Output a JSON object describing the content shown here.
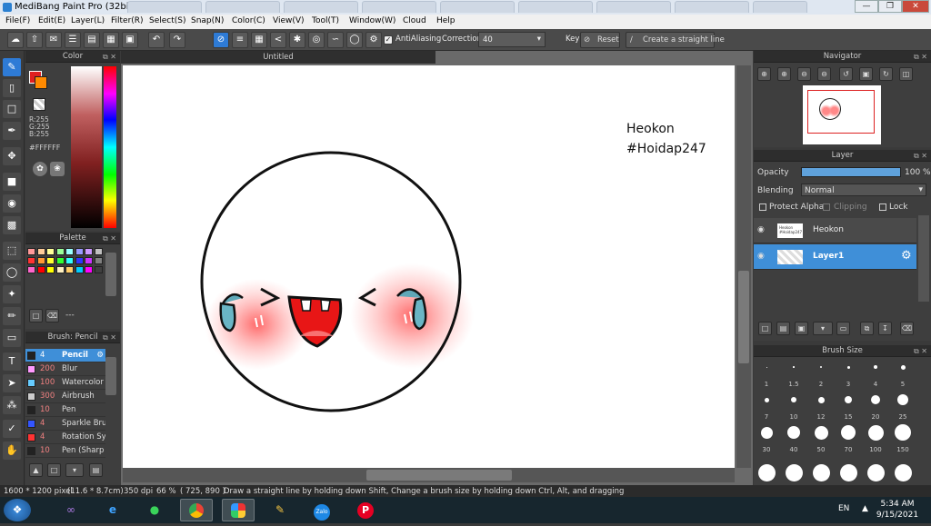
{
  "window": {
    "title": "MediBang Paint Pro (32bit)"
  },
  "menu": [
    "File(F)",
    "Edit(E)",
    "Layer(L)",
    "Filter(R)",
    "Select(S)",
    "Snap(N)",
    "Color(C)",
    "View(V)",
    "Tool(T)",
    "Window(W)",
    "Cloud",
    "Help"
  ],
  "toolbar": {
    "antialias_label": "AntiAliasing",
    "correction_label": "Correction",
    "correction_value": "40",
    "key_label": "Key",
    "reset_label": "Reset",
    "straight_line_label": "Create a straight line"
  },
  "color_panel": {
    "title": "Color",
    "r": "R:255",
    "g": "G:255",
    "b": "B:255",
    "hex": "#FFFFFF"
  },
  "palette_panel": {
    "title": "Palette",
    "extra": "---",
    "colors": [
      "#ff9999",
      "#ffcc99",
      "#ffff99",
      "#99ff99",
      "#99ffff",
      "#9999ff",
      "#cc99ff",
      "#c0c0c0",
      "#ff3333",
      "#ff9933",
      "#ffff33",
      "#33ff33",
      "#33ffff",
      "#3333ff",
      "#cc33ff",
      "#808080",
      "#ff66cc",
      "#ff0000",
      "#ffff00",
      "#fff0c0",
      "#ffcc66",
      "#00ccff",
      "#ff00ff",
      "#404040"
    ]
  },
  "brush_panel": {
    "title": "Brush: Pencil",
    "brushes": [
      {
        "size": "4",
        "name": "Pencil",
        "color": "#222222",
        "selected": true
      },
      {
        "size": "200",
        "name": "Blur",
        "color": "#ff99ff",
        "selected": false
      },
      {
        "size": "100",
        "name": "Watercolor",
        "color": "#66ccff",
        "selected": false
      },
      {
        "size": "300",
        "name": "Airbrush",
        "color": "#cccccc",
        "selected": false
      },
      {
        "size": "10",
        "name": "Pen",
        "color": "#222222",
        "selected": false
      },
      {
        "size": "4",
        "name": "Sparkle Bru",
        "color": "#3355ff",
        "selected": false
      },
      {
        "size": "4",
        "name": "Rotation Sy",
        "color": "#ff3333",
        "selected": false
      },
      {
        "size": "10",
        "name": "Pen (Sharp",
        "color": "#222222",
        "selected": false
      }
    ]
  },
  "document": {
    "tab_title": "Untitled",
    "canvas_text_line1": "Heokon",
    "canvas_text_line2": "#Hoidap247"
  },
  "navigator": {
    "title": "Navigator"
  },
  "layer_panel": {
    "title": "Layer",
    "opacity_label": "Opacity",
    "opacity_value": "100 %",
    "opacity_fraction": 1.0,
    "blending_label": "Blending",
    "blending_value": "Normal",
    "protect_alpha": "Protect Alpha",
    "clipping": "Clipping",
    "lock": "Lock",
    "layers": [
      {
        "name": "Heokon",
        "selected": false
      },
      {
        "name": "Layer1",
        "selected": true
      }
    ]
  },
  "brush_size_panel": {
    "title": "Brush Size",
    "sizes": [
      "1",
      "1.5",
      "2",
      "3",
      "4",
      "5",
      "7",
      "10",
      "12",
      "15",
      "20",
      "25",
      "30",
      "40",
      "50",
      "70",
      "100",
      "150"
    ]
  },
  "status": {
    "dimensions": "1600 * 1200 pixel",
    "physical": "(11.6 * 8.7cm)",
    "dpi": "350 dpi",
    "zoom": "66 %",
    "coords": "( 725, 890 )",
    "hint": "Draw a straight line by holding down Shift, Change a brush size by holding down Ctrl, Alt, and dragging"
  },
  "taskbar": {
    "lang": "EN",
    "time": "5:34 AM",
    "date": "9/15/2021",
    "apps": [
      "start",
      "visual-studio",
      "internet-explorer",
      "wechat",
      "chrome",
      "medibang",
      "paint",
      "zalo",
      "pinterest"
    ]
  }
}
